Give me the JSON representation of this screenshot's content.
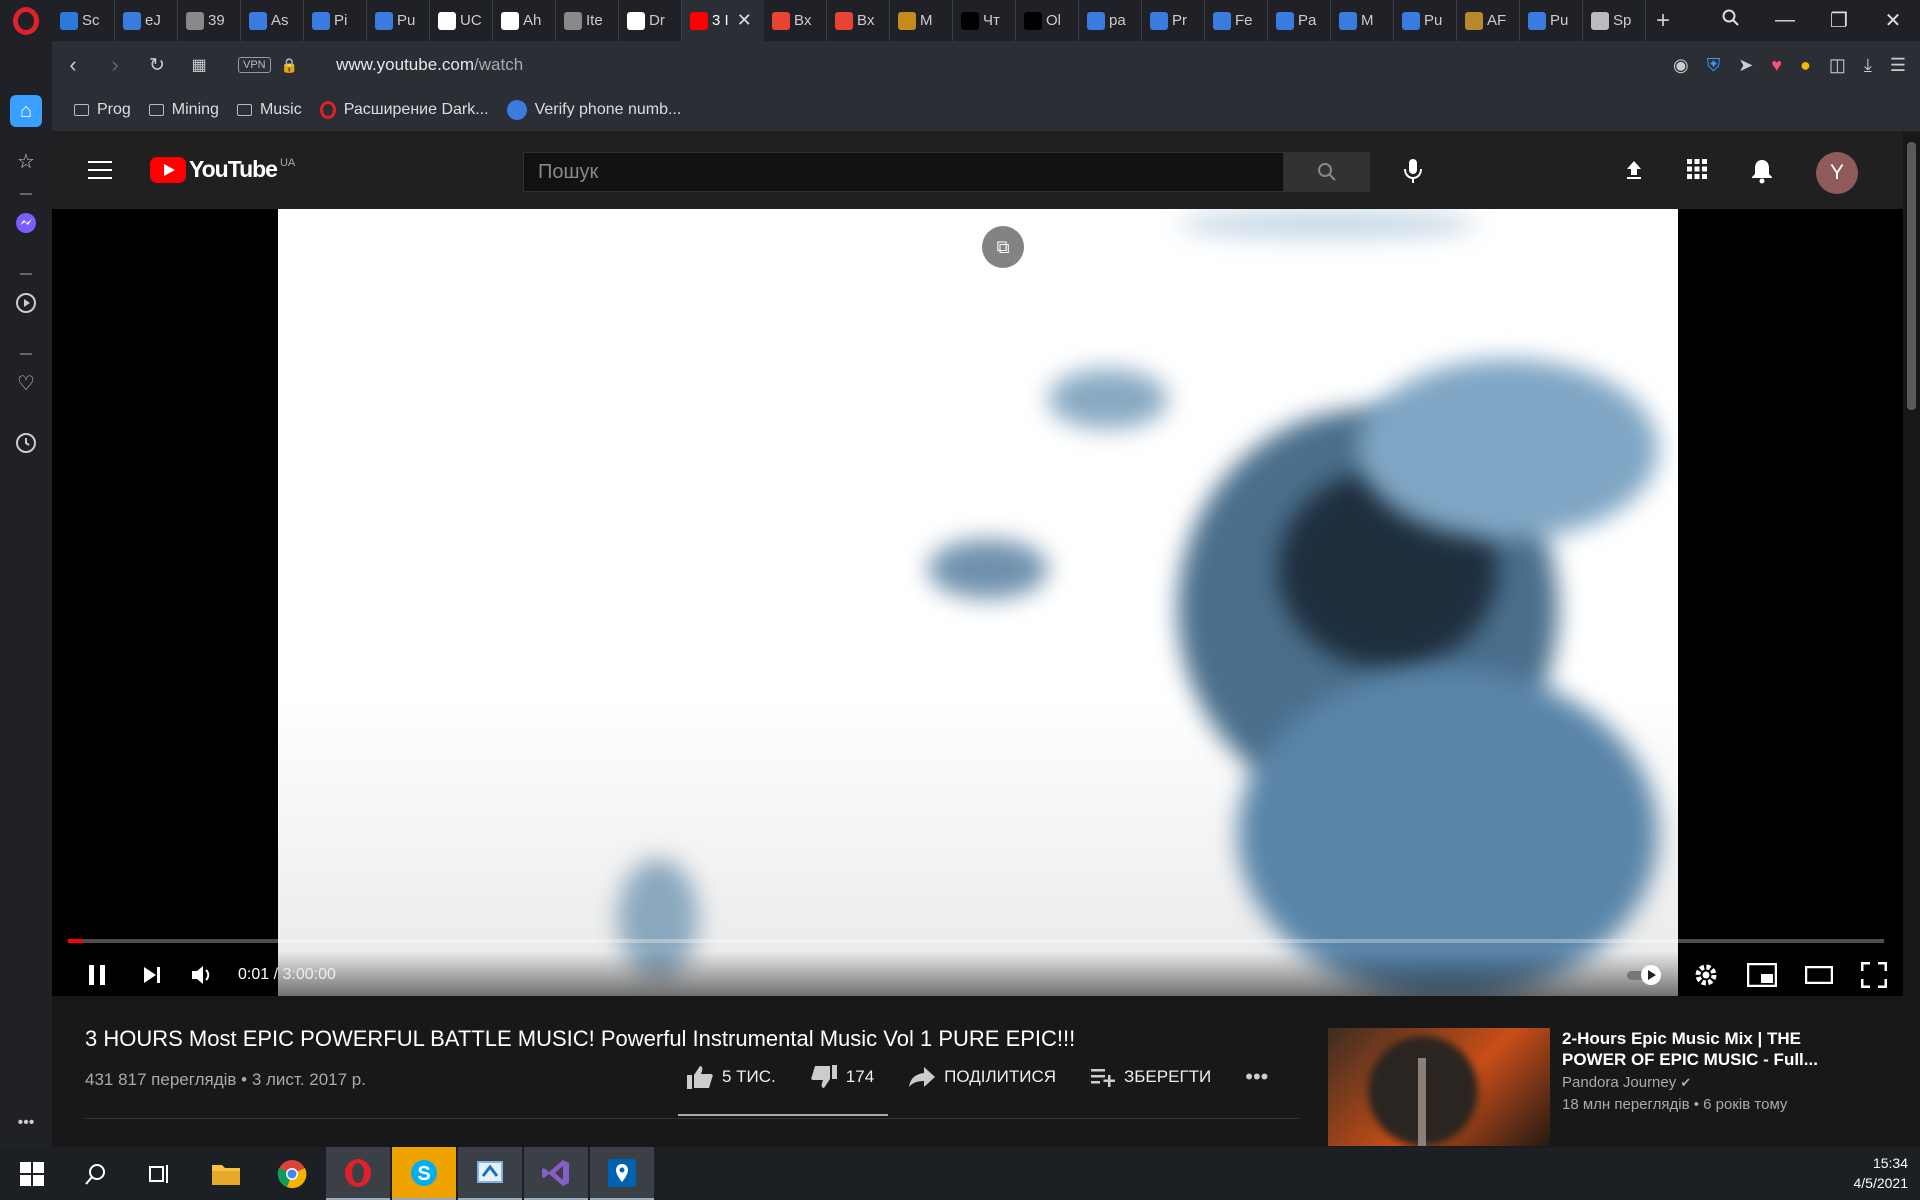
{
  "browser": {
    "tabs": [
      {
        "label": "Sc",
        "color": "#2a7bd8"
      },
      {
        "label": "eJ",
        "color": "#3a7be0"
      },
      {
        "label": "39",
        "color": "#888888"
      },
      {
        "label": "As",
        "color": "#3a7be0"
      },
      {
        "label": "Pi",
        "color": "#3a7be0"
      },
      {
        "label": "Pu",
        "color": "#3a7be0"
      },
      {
        "label": "UC",
        "color": "#ffffff"
      },
      {
        "label": "Ah",
        "color": "#ffffff"
      },
      {
        "label": "Ite",
        "color": "#888888"
      },
      {
        "label": "Dr",
        "color": "#ffffff"
      },
      {
        "label": "3 I",
        "color": "#ff0000",
        "active": true
      },
      {
        "label": "Bx",
        "color": "#ea4335"
      },
      {
        "label": "Bx",
        "color": "#ea4335"
      },
      {
        "label": "M",
        "color": "#c58b1c"
      },
      {
        "label": "Чт",
        "color": "#000000"
      },
      {
        "label": "Ol",
        "color": "#000000"
      },
      {
        "label": "pa",
        "color": "#3a7be0"
      },
      {
        "label": "Pr",
        "color": "#3a7be0"
      },
      {
        "label": "Fe",
        "color": "#3a7be0"
      },
      {
        "label": "Pa",
        "color": "#3a7be0"
      },
      {
        "label": "M",
        "color": "#3a7be0"
      },
      {
        "label": "Pu",
        "color": "#3a7be0"
      },
      {
        "label": "AF",
        "color": "#b7892d"
      },
      {
        "label": "Pu",
        "color": "#3a7be0"
      },
      {
        "label": "Sp",
        "color": "#bbbbbb"
      }
    ],
    "vpn_label": "VPN",
    "url_host": "www.youtube.com",
    "url_path": "/watch",
    "bookmarks": [
      {
        "label": "Prog",
        "icon": "folder-icon"
      },
      {
        "label": "Mining",
        "icon": "folder-icon"
      },
      {
        "label": "Music",
        "icon": "folder-icon"
      },
      {
        "label": "Расширение Dark...",
        "icon": "opera-icon"
      },
      {
        "label": "Verify phone numb...",
        "icon": "verify-icon"
      }
    ]
  },
  "youtube": {
    "logo_text": "YouTube",
    "country_code": "UA",
    "search_placeholder": "Пошук",
    "avatar_letter": "Y",
    "player": {
      "current_time": "0:01",
      "duration": "3:00:00",
      "progress_fraction": 0.0001,
      "separator": " / "
    },
    "video": {
      "title": "3 HOURS Most EPIC POWERFUL BATTLE MUSIC! Powerful Instrumental Music Vol 1 PURE EPIC!!!",
      "views_date": "431 817 переглядів • 3 лист. 2017 р.",
      "likes": "5 ТИС.",
      "dislikes": "174",
      "share_label": "ПОДІЛИТИСЯ",
      "save_label": "ЗБЕРЕГТИ"
    },
    "recommendation": {
      "title": "2-Hours Epic Music Mix | THE POWER OF EPIC MUSIC - Full...",
      "channel": "Pandora Journey",
      "meta": "18 млн переглядів • 6 років тому"
    }
  },
  "taskbar": {
    "time": "15:34",
    "date": "4/5/2021"
  }
}
